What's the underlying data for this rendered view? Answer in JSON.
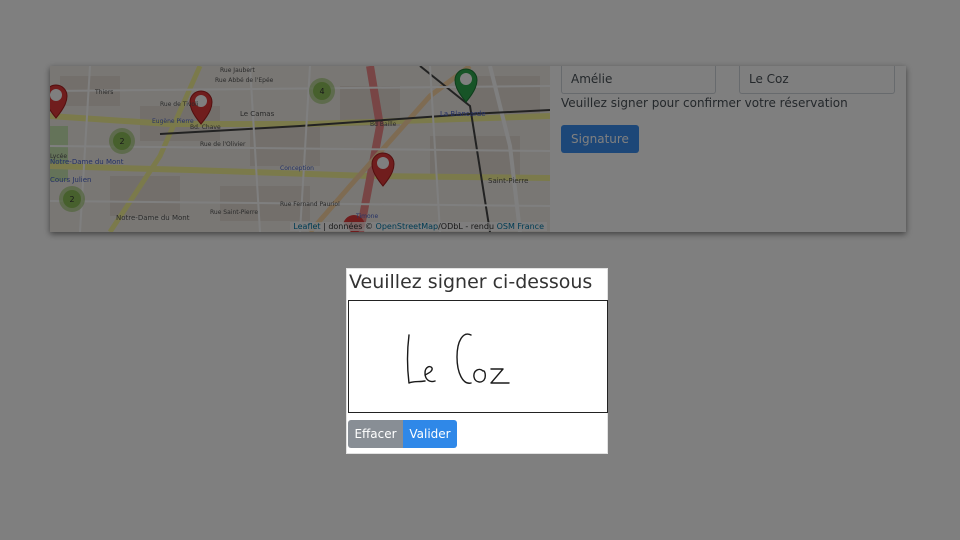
{
  "map": {
    "icon": "leaflet-map",
    "street_labels": [
      "Rue Jaubert",
      "Rue Abbé de l'Epée",
      "Thiers",
      "Rue de Tivoli",
      "Le Camas",
      "Eugène Pierre",
      "Bd. Chave",
      "Bd Baille",
      "La Blancarde",
      "Rue de l'Olivier",
      "Notre-Dame du Mont",
      "Cours Julien",
      "Notre-Dame du Mont",
      "Saint-Pierre",
      "Rue Saint-Pierre",
      "Lycée",
      "Rue Fernand Pauriol",
      "Timone",
      "Conception"
    ],
    "cluster_counts": [
      "4",
      "2",
      "2"
    ],
    "attribution": {
      "leaflet": "Leaflet",
      "donnees": "| données ©",
      "osm": "OpenStreetMap",
      "odbl": "/ODbL - rendu",
      "osm_france": "OSM France"
    }
  },
  "form": {
    "first_name_value": "Amélie",
    "last_name_value": "Le Coz",
    "hint": "Veuillez signer pour confirmer votre réservation",
    "signature_button": "Signature"
  },
  "modal": {
    "title": "Veuillez signer ci-dessous",
    "signature_icon": "handwritten-signature",
    "clear_button": "Effacer",
    "validate_button": "Valider"
  },
  "colors": {
    "primary": "#3b8ff0",
    "overlay": "rgba(0,0,0,0.5)",
    "marker_red": "#e03a3a",
    "marker_green": "#2fa84f",
    "cluster_green": "#8fc15a"
  }
}
